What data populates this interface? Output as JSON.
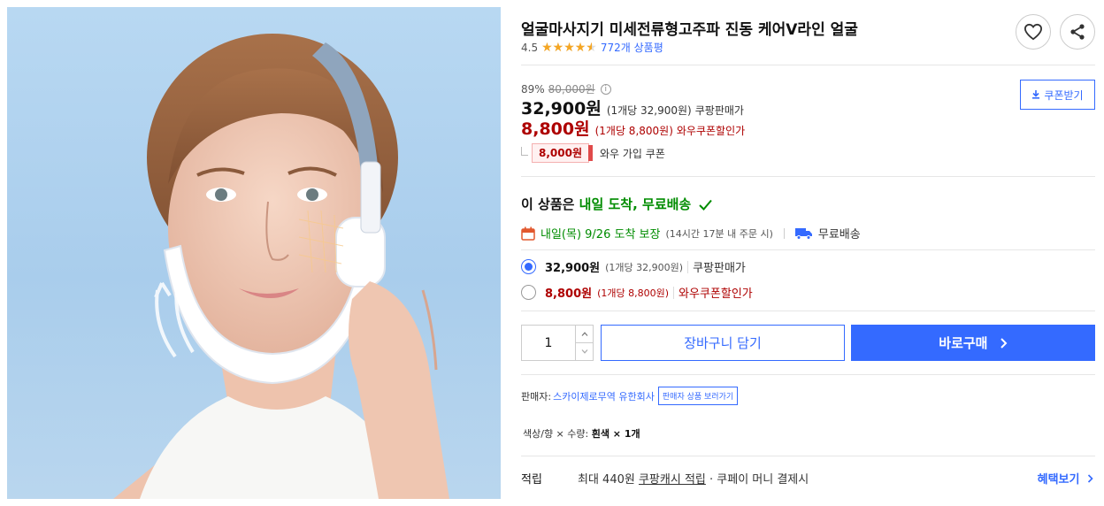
{
  "product": {
    "title": "얼굴마사지기 미세전류형고주파 진동 케어V라인 얼굴",
    "rating": "4.5",
    "rating_value": 4.5,
    "rating_max": 5,
    "review_count": "772개 상품평"
  },
  "pricing": {
    "discount_rate": "89%",
    "original_price": "80,000원",
    "coupon_button": "쿠폰받기",
    "sale_price": "32,900원",
    "sale_unit": "(1개당 32,900원)",
    "sale_type": "쿠팡판매가",
    "wow_price": "8,800원",
    "wow_unit": "(1개당 8,800원)",
    "wow_type": "와우쿠폰할인가",
    "coupon_amount": "8,000원",
    "coupon_label": "와우 가입 쿠폰"
  },
  "delivery": {
    "headline_prefix": "이 상품은",
    "headline_green": "내일 도착, 무료배송",
    "arrival": "내일(목) 9/26 도착 보장",
    "deadline": "(14시간 17분 내 주문 시)",
    "free_shipping": "무료배송"
  },
  "options": [
    {
      "price": "32,900원",
      "unit": "(1개당 32,900원)",
      "type": "쿠팡판매가",
      "selected": true
    },
    {
      "price": "8,800원",
      "unit": "(1개당 8,800원)",
      "type": "와우쿠폰할인가",
      "selected": false
    }
  ],
  "purchase": {
    "quantity": "1",
    "cart_label": "장바구니 담기",
    "buy_label": "바로구매"
  },
  "seller": {
    "label": "판매자:",
    "name": "스카이제로무역 유한회사",
    "link_label": "판매자 상품 보러가기"
  },
  "option_summary": {
    "text": "색상/향 × 수량:",
    "value": "흰색 × 1개"
  },
  "reward": {
    "label": "적립",
    "prefix": "최대 440원",
    "link": "쿠팡캐시 적립",
    "suffix": "· 쿠페이 머니 결제시",
    "benefit_link": "혜택보기"
  },
  "colors": {
    "accent": "#346aff",
    "wow_red": "#ae0000",
    "green": "#008c00",
    "star": "#f5a623"
  }
}
